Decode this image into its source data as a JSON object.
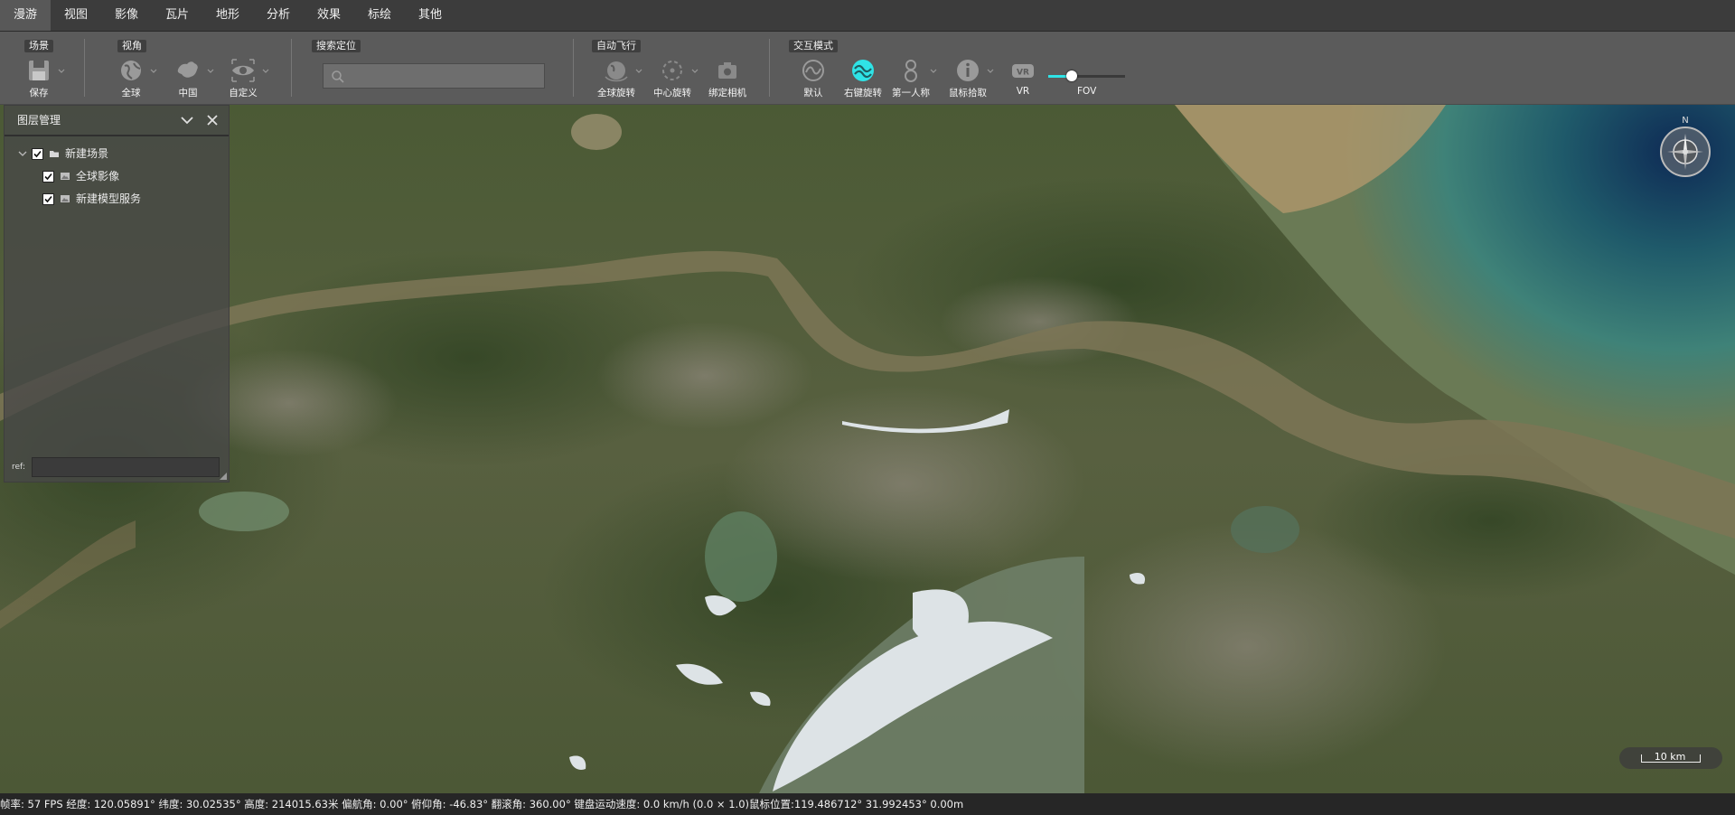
{
  "menu": [
    "漫游",
    "视图",
    "影像",
    "瓦片",
    "地形",
    "分析",
    "效果",
    "标绘",
    "其他"
  ],
  "ribbon": {
    "scene_group": "场景",
    "save": "保存",
    "view_group": "视角",
    "globe": "全球",
    "china": "中国",
    "custom": "自定义",
    "search_group": "搜索定位",
    "search_value": "",
    "search_placeholder": "",
    "autofly_group": "自动飞行",
    "global_rotate": "全球旋转",
    "center_rotate": "中心旋转",
    "bind_camera": "绑定相机",
    "interact_group": "交互模式",
    "default_mode": "默认",
    "right_rotate": "右键旋转",
    "first_person": "第一人称",
    "mouse_pick": "鼠标拾取",
    "vr": "VR",
    "vr_icon_text": "VR",
    "fov_label": "FOV",
    "fov_level": 0.3,
    "accent": "#2fe3e6"
  },
  "layer_panel": {
    "title": "图层管理",
    "tree": [
      {
        "label": "新建场景",
        "checked": true,
        "kind": "folder"
      },
      {
        "label": "全球影像",
        "checked": true,
        "kind": "layer"
      },
      {
        "label": "新建模型服务",
        "checked": true,
        "kind": "layer"
      }
    ],
    "ref_label": "ref:",
    "ref_value": ""
  },
  "compass": {
    "north": "N"
  },
  "scale": {
    "label": "10 km"
  },
  "status": "帧率: 57 FPS 经度: 120.05891° 纬度: 30.02535° 高度: 214015.63米 偏航角: 0.00° 俯仰角: -46.83° 翻滚角: 360.00° 键盘运动速度: 0.0 km/h (0.0 × 1.0)鼠标位置:119.486712° 31.992453° 0.00m"
}
